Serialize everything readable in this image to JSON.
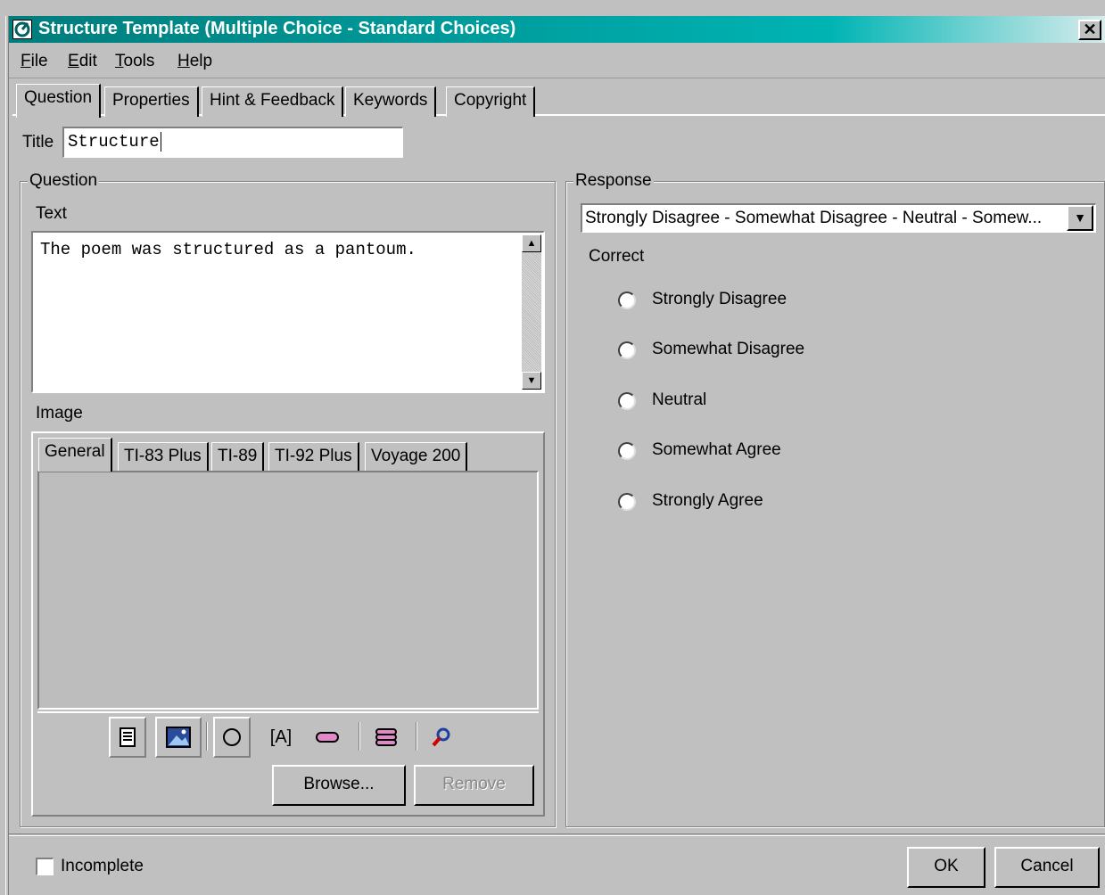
{
  "window": {
    "title": "Structure Template (Multiple Choice - Standard Choices)",
    "close_glyph": "✕"
  },
  "menu": {
    "items": [
      "File",
      "Edit",
      "Tools",
      "Help"
    ]
  },
  "tabs": [
    "Question",
    "Properties",
    "Hint & Feedback",
    "Keywords",
    "Copyright"
  ],
  "active_tab": "Question",
  "title_field": {
    "label": "Title",
    "value": "Structure"
  },
  "question": {
    "group_title": "Question",
    "text_label": "Text",
    "text_value": "The poem was structured as a pantoum.",
    "image_label": "Image",
    "image_tabs": [
      "General",
      "TI-83 Plus",
      "TI-89",
      "TI-92 Plus",
      "Voyage 200"
    ],
    "active_image_tab": "General",
    "toolbar_icons": [
      "document-icon",
      "image-icon",
      "circle-icon",
      "text-box-icon",
      "eraser-icon",
      "layers-icon",
      "zoom-icon"
    ],
    "text_box_glyph": "[A]",
    "browse_label": "Browse...",
    "remove_label": "Remove"
  },
  "response": {
    "group_title": "Response",
    "selected": "Strongly Disagree - Somewhat Disagree - Neutral - Somew...",
    "correct_label": "Correct",
    "choices": [
      "Strongly Disagree",
      "Somewhat Disagree",
      "Neutral",
      "Somewhat Agree",
      "Strongly Agree"
    ]
  },
  "footer": {
    "incomplete_label": "Incomplete",
    "incomplete_checked": false,
    "ok_label": "OK",
    "cancel_label": "Cancel"
  }
}
